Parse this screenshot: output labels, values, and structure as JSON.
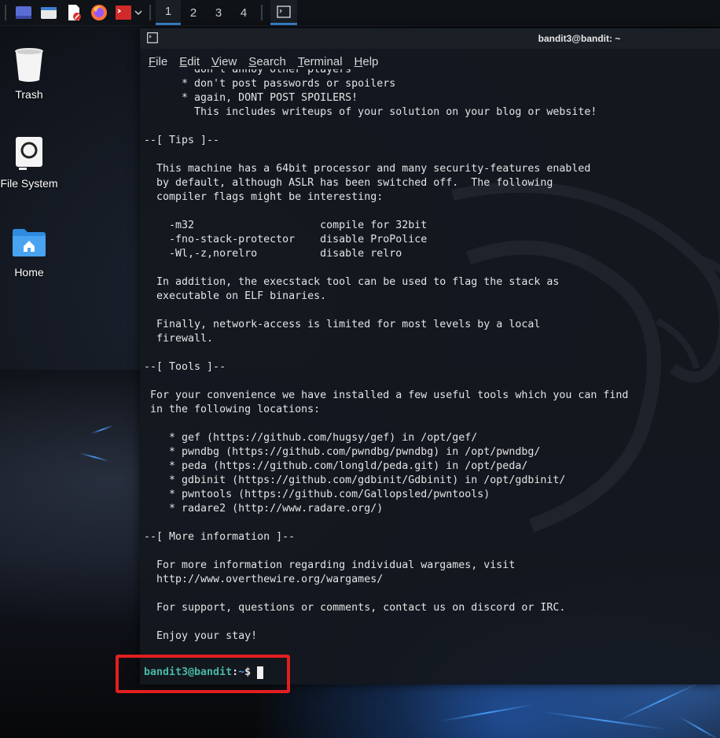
{
  "panel": {
    "launchers": [
      {
        "name": "show-desktop-icon",
        "color": "#5a6cd6"
      },
      {
        "name": "file-manager-icon",
        "color": "#e8e8e8"
      },
      {
        "name": "text-editor-icon",
        "color": "#ffffff"
      },
      {
        "name": "firefox-icon",
        "color": "#ff7139"
      },
      {
        "name": "terminal-emulator-icon",
        "color": "#d12a2a"
      }
    ],
    "workspaces": [
      "1",
      "2",
      "3",
      "4"
    ],
    "active_workspace": "1"
  },
  "desktop": {
    "icons": [
      {
        "label": "Trash"
      },
      {
        "label": "File System"
      },
      {
        "label": "Home"
      }
    ]
  },
  "terminal": {
    "title": "bandit3@bandit: ~",
    "menu": [
      {
        "underline": "F",
        "rest": "ile"
      },
      {
        "underline": "E",
        "rest": "dit"
      },
      {
        "underline": "V",
        "rest": "iew"
      },
      {
        "underline": "S",
        "rest": "earch"
      },
      {
        "underline": "T",
        "rest": "erminal"
      },
      {
        "underline": "H",
        "rest": "elp"
      }
    ],
    "output": "      * don't annoy other players\n      * don't post passwords or spoilers\n      * again, DONT POST SPOILERS!\n        This includes writeups of your solution on your blog or website!\n\n--[ Tips ]--\n\n  This machine has a 64bit processor and many security-features enabled\n  by default, although ASLR has been switched off.  The following\n  compiler flags might be interesting:\n\n    -m32                    compile for 32bit\n    -fno-stack-protector    disable ProPolice\n    -Wl,-z,norelro          disable relro\n\n  In addition, the execstack tool can be used to flag the stack as\n  executable on ELF binaries.\n\n  Finally, network-access is limited for most levels by a local\n  firewall.\n\n--[ Tools ]--\n\n For your convenience we have installed a few useful tools which you can find\n in the following locations:\n\n    * gef (https://github.com/hugsy/gef) in /opt/gef/\n    * pwndbg (https://github.com/pwndbg/pwndbg) in /opt/pwndbg/\n    * peda (https://github.com/longld/peda.git) in /opt/peda/\n    * gdbinit (https://github.com/gdbinit/Gdbinit) in /opt/gdbinit/\n    * pwntools (https://github.com/Gallopsled/pwntools)\n    * radare2 (http://www.radare.org/)\n\n--[ More information ]--\n\n  For more information regarding individual wargames, visit\n  http://www.overthewire.org/wargames/\n\n  For support, questions or comments, contact us on discord or IRC.\n\n  Enjoy your stay!",
    "prompt": {
      "user_host": "bandit3@bandit",
      "path": "~",
      "symbol": "$"
    },
    "colors": {
      "user_host": "#48b9a3",
      "path": "#5c8fe6",
      "text": "#e4e4e4",
      "highlight": "#e21f1f"
    }
  }
}
